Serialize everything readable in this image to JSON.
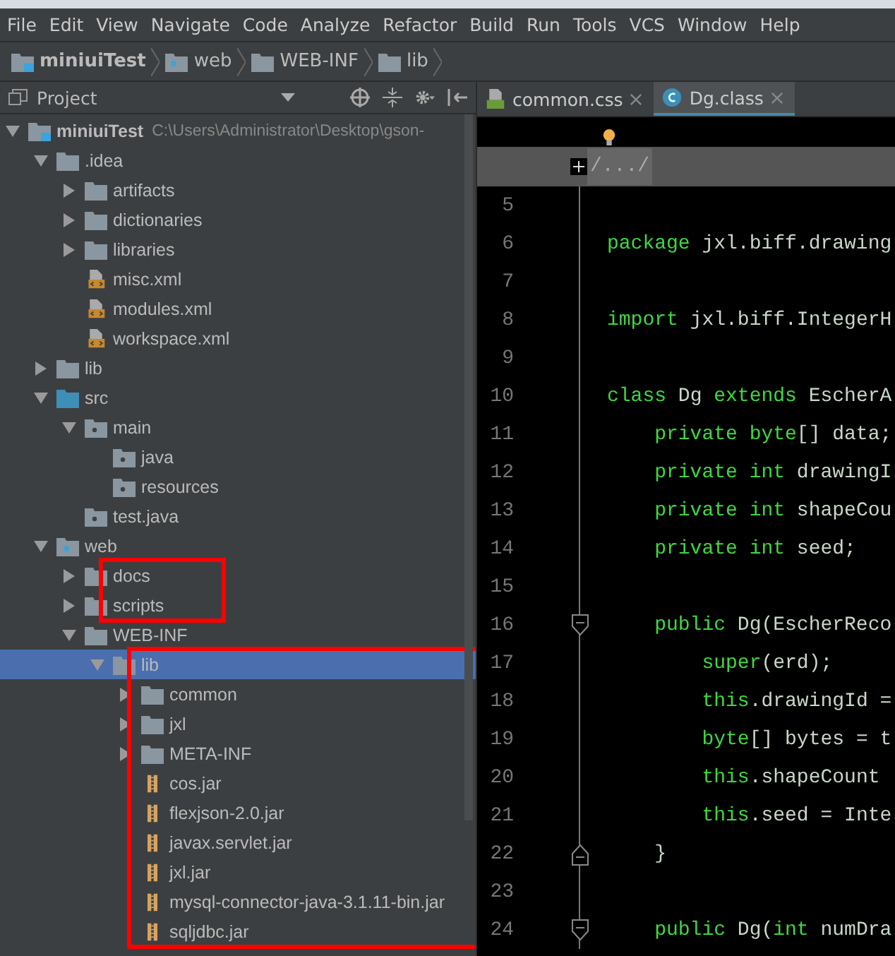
{
  "menu": [
    "File",
    "Edit",
    "View",
    "Navigate",
    "Code",
    "Analyze",
    "Refactor",
    "Build",
    "Run",
    "Tools",
    "VCS",
    "Window",
    "Help"
  ],
  "breadcrumb": [
    {
      "label": "miniuiTest",
      "kind": "module"
    },
    {
      "label": "web",
      "kind": "web-folder"
    },
    {
      "label": "WEB-INF",
      "kind": "folder"
    },
    {
      "label": "lib",
      "kind": "folder"
    }
  ],
  "project_panel": {
    "title": "Project"
  },
  "editor_tabs": [
    {
      "label": "common.css",
      "kind": "css",
      "selected": false
    },
    {
      "label": "Dg.class",
      "kind": "class",
      "selected": true
    }
  ],
  "tree": [
    {
      "label": "miniuiTest",
      "path": "C:\\Users\\Administrator\\Desktop\\gson-",
      "kind": "module",
      "expanded": true,
      "children": [
        {
          "label": ".idea",
          "kind": "folder",
          "expanded": true,
          "children": [
            {
              "label": "artifacts",
              "kind": "folder",
              "expanded": false
            },
            {
              "label": "dictionaries",
              "kind": "folder",
              "expanded": false
            },
            {
              "label": "libraries",
              "kind": "folder",
              "expanded": false
            },
            {
              "label": "misc.xml",
              "kind": "xml"
            },
            {
              "label": "modules.xml",
              "kind": "xml"
            },
            {
              "label": "workspace.xml",
              "kind": "xml"
            }
          ]
        },
        {
          "label": "lib",
          "kind": "folder",
          "expanded": false
        },
        {
          "label": "src",
          "kind": "source-folder",
          "expanded": true,
          "children": [
            {
              "label": "main",
              "kind": "package",
              "expanded": true,
              "children": [
                {
                  "label": "java",
                  "kind": "package"
                },
                {
                  "label": "resources",
                  "kind": "package"
                }
              ]
            },
            {
              "label": "test.java",
              "kind": "package"
            }
          ]
        },
        {
          "label": "web",
          "kind": "web-folder",
          "expanded": true,
          "children": [
            {
              "label": "docs",
              "kind": "folder",
              "expanded": false,
              "annotated": true
            },
            {
              "label": "scripts",
              "kind": "folder",
              "expanded": false,
              "annotated": true
            },
            {
              "label": "WEB-INF",
              "kind": "folder",
              "expanded": true,
              "children": [
                {
                  "label": "lib",
                  "kind": "folder",
                  "expanded": true,
                  "selected": true,
                  "annotated": true,
                  "children": [
                    {
                      "label": "common",
                      "kind": "folder",
                      "expanded": false
                    },
                    {
                      "label": "jxl",
                      "kind": "folder",
                      "expanded": false
                    },
                    {
                      "label": "META-INF",
                      "kind": "folder",
                      "expanded": false
                    },
                    {
                      "label": "cos.jar",
                      "kind": "jar"
                    },
                    {
                      "label": "flexjson-2.0.jar",
                      "kind": "jar"
                    },
                    {
                      "label": "javax.servlet.jar",
                      "kind": "jar"
                    },
                    {
                      "label": "jxl.jar",
                      "kind": "jar"
                    },
                    {
                      "label": "mysql-connector-java-3.1.11-bin.jar",
                      "kind": "jar"
                    },
                    {
                      "label": "sqljdbc.jar",
                      "kind": "jar"
                    }
                  ]
                }
              ]
            }
          ]
        }
      ]
    }
  ],
  "editor": {
    "folded_header": "/.../",
    "lines": [
      {
        "number": "5"
      },
      {
        "number": "6",
        "tokens": [
          {
            "text": "package",
            "kind": "keyword"
          },
          {
            "text": " jxl.biff.drawing",
            "kind": "plain"
          }
        ]
      },
      {
        "number": "7"
      },
      {
        "number": "8",
        "tokens": [
          {
            "text": "import",
            "kind": "keyword"
          },
          {
            "text": " jxl.biff.IntegerH",
            "kind": "plain"
          }
        ]
      },
      {
        "number": "9"
      },
      {
        "number": "10",
        "tokens": [
          {
            "text": "class",
            "kind": "keyword"
          },
          {
            "text": " Dg ",
            "kind": "plain"
          },
          {
            "text": "extends",
            "kind": "keyword"
          },
          {
            "text": " EscherA",
            "kind": "plain"
          }
        ]
      },
      {
        "number": "11",
        "tokens": [
          {
            "text": "    private byte",
            "kind": "keyword"
          },
          {
            "text": "[] data;",
            "kind": "plain"
          }
        ]
      },
      {
        "number": "12",
        "tokens": [
          {
            "text": "    private int",
            "kind": "keyword"
          },
          {
            "text": " drawingI",
            "kind": "plain"
          }
        ]
      },
      {
        "number": "13",
        "tokens": [
          {
            "text": "    private int",
            "kind": "keyword"
          },
          {
            "text": " shapeCou",
            "kind": "plain"
          }
        ]
      },
      {
        "number": "14",
        "tokens": [
          {
            "text": "    private int",
            "kind": "keyword"
          },
          {
            "text": " seed;",
            "kind": "plain"
          }
        ]
      },
      {
        "number": "15"
      },
      {
        "number": "16",
        "fold_start": true,
        "tokens": [
          {
            "text": "    public",
            "kind": "keyword"
          },
          {
            "text": " Dg(EscherReco",
            "kind": "plain"
          }
        ]
      },
      {
        "number": "17",
        "tokens": [
          {
            "text": "        super",
            "kind": "keyword"
          },
          {
            "text": "(erd);",
            "kind": "plain"
          }
        ]
      },
      {
        "number": "18",
        "tokens": [
          {
            "text": "        this",
            "kind": "keyword"
          },
          {
            "text": ".drawingId =",
            "kind": "plain"
          }
        ]
      },
      {
        "number": "19",
        "tokens": [
          {
            "text": "        byte",
            "kind": "keyword"
          },
          {
            "text": "[] bytes = t",
            "kind": "plain"
          }
        ]
      },
      {
        "number": "20",
        "tokens": [
          {
            "text": "        this",
            "kind": "keyword"
          },
          {
            "text": ".shapeCount",
            "kind": "plain"
          }
        ]
      },
      {
        "number": "21",
        "tokens": [
          {
            "text": "        this",
            "kind": "keyword"
          },
          {
            "text": ".seed = Inte",
            "kind": "plain"
          }
        ]
      },
      {
        "number": "22",
        "fold_end": true,
        "tokens": [
          {
            "text": "    }",
            "kind": "plain"
          }
        ]
      },
      {
        "number": "23"
      },
      {
        "number": "24",
        "fold_start": true,
        "tokens": [
          {
            "text": "    public",
            "kind": "keyword"
          },
          {
            "text": " Dg(",
            "kind": "plain"
          },
          {
            "text": "int",
            "kind": "keyword"
          },
          {
            "text": " numDra",
            "kind": "plain"
          }
        ]
      }
    ]
  }
}
